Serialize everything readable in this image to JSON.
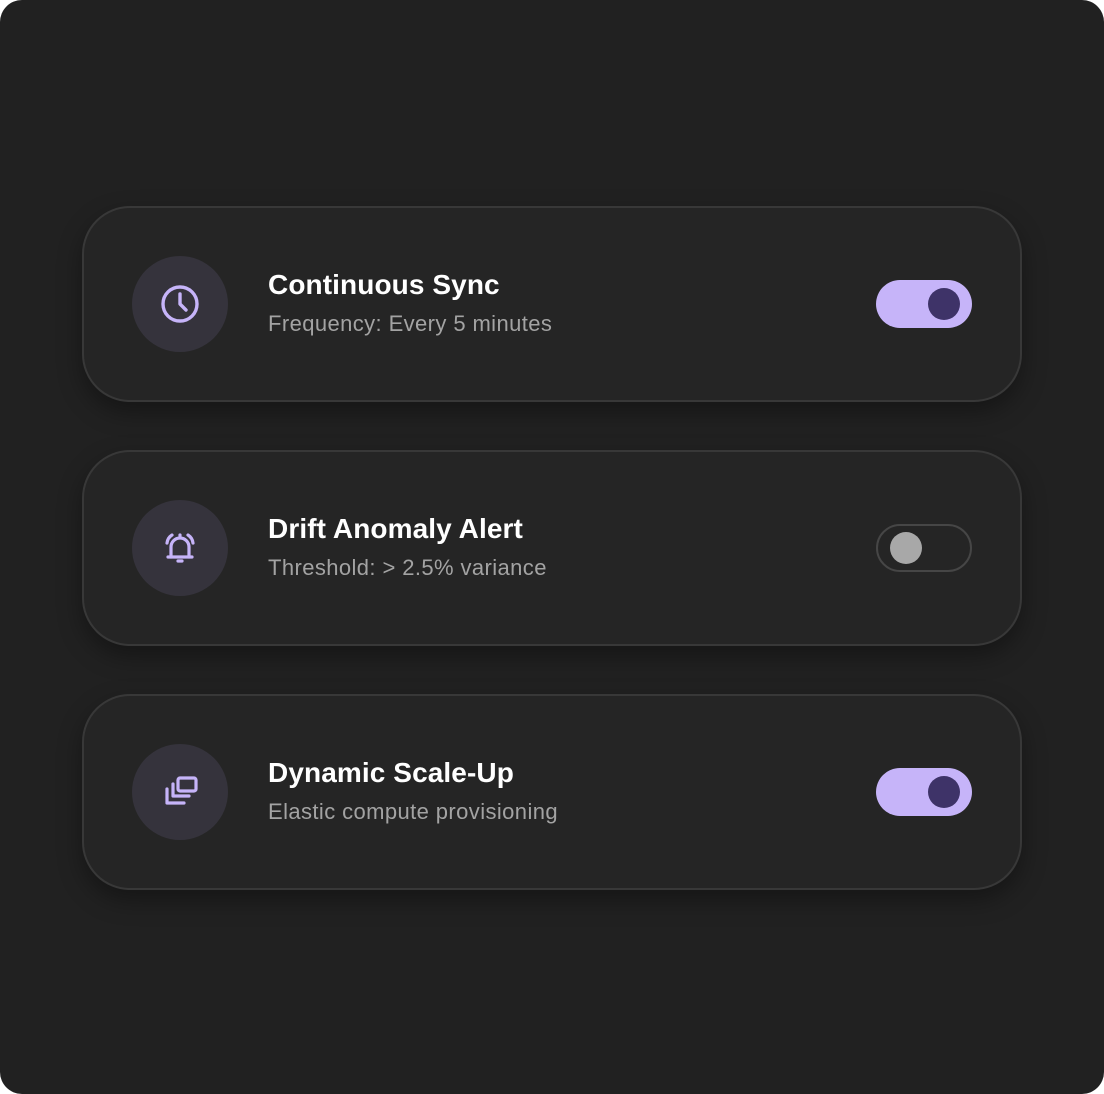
{
  "colors": {
    "background": "#212121",
    "card_background": "#252525",
    "card_border": "#383838",
    "accent": "#c6b4f9",
    "knob_on": "#3e3368",
    "knob_off": "#a8a8a8",
    "icon_bg": "#35333c"
  },
  "settings": [
    {
      "icon": "clock-icon",
      "title": "Continuous Sync",
      "subtitle": "Frequency: Every 5 minutes",
      "enabled": true
    },
    {
      "icon": "bell-ringing-icon",
      "title": "Drift Anomaly Alert",
      "subtitle": "Threshold: > 2.5% variance",
      "enabled": false
    },
    {
      "icon": "stacked-windows-icon",
      "title": "Dynamic Scale-Up",
      "subtitle": "Elastic compute provisioning",
      "enabled": true
    }
  ]
}
